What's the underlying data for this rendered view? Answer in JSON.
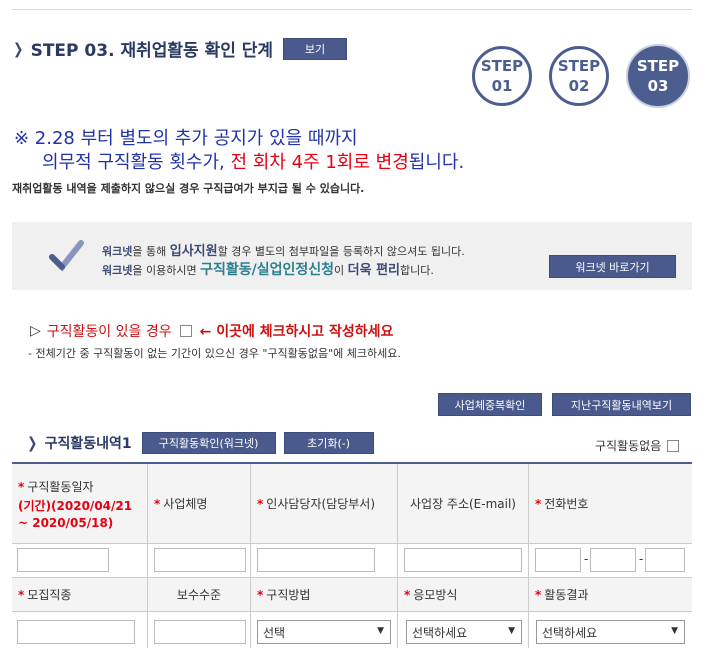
{
  "step_header": {
    "title": "STEP 03. 재취업활동 확인 단계",
    "view_button": "보기",
    "steps": [
      {
        "label": "STEP",
        "number": "01",
        "active": false
      },
      {
        "label": "STEP",
        "number": "02",
        "active": false
      },
      {
        "label": "STEP",
        "number": "03",
        "active": true
      }
    ]
  },
  "notice": {
    "line1": "※ 2.28 부터 별도의 추가 공지가 있을 때까지",
    "line2_prefix": "의무적 구직활동 횟수가, ",
    "line2_highlight": "전 회차 4주 1회로 변경",
    "line2_suffix": "됩니다.",
    "line3": "재취업활동 내역을 제출하지 않으실 경우 구직급여가 부지급 될 수 있습니다."
  },
  "worknet": {
    "line1_a": "워크넷",
    "line1_b": "을 통해 ",
    "line1_c": "입사지원",
    "line1_d": "할 경우 별도의 첨부파일을 등록하지 않으셔도 됩니다.",
    "line2_a": "워크넷",
    "line2_b": "을 이용하시면 ",
    "line2_c": "구직활동/실업인정신청",
    "line2_d": "이 ",
    "line2_e": "더욱 편리",
    "line2_f": "합니다.",
    "button": "워크넷 바로가기"
  },
  "activity_check": {
    "triangle": "▷",
    "label": "구직활동이 있을 경우",
    "instruction": "← 이곳에 체크하시고 작성하세요",
    "hint": "- 전체기간 중 구직활동이 없는 기간이 있으신 경우 \"구직활동없음\"에 체크하세요."
  },
  "buttons": {
    "biz_dup_check": "사업체중복확인",
    "past_history": "지난구직활동내역보기"
  },
  "list": {
    "title": "구직활동내역1",
    "worknet_confirm": "구직활동확인(워크넷)",
    "reset": "초기화(-)",
    "no_activity": "구직활동없음"
  },
  "table": {
    "required_mark": "*",
    "row1": {
      "activity_date": "구직활동일자",
      "period": "(기간)(2020/04/21",
      "period2": "~ 2020/05/18)",
      "company": "사업체명",
      "hr_contact": "인사담당자(담당부서)",
      "address": "사업장 주소(E-mail)",
      "phone": "전화번호",
      "phone_sep": "-"
    },
    "row2": {
      "job_type": "모집직종",
      "salary": "보수수준",
      "method": "구직방법",
      "apply_type": "응모방식",
      "result": "활동결과"
    },
    "selects": {
      "method": "선택",
      "apply_type": "선택하세요",
      "result": "선택하세요"
    }
  }
}
